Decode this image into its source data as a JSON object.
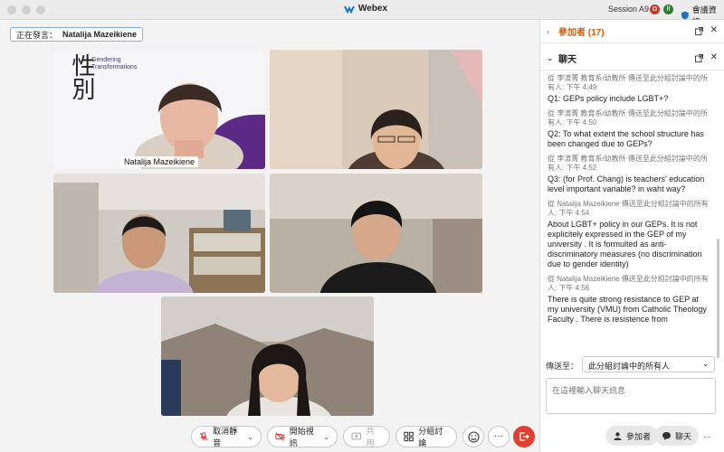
{
  "window": {
    "app_name": "Webex",
    "session": "Session A9",
    "meeting_info": "會議資訊",
    "badges": [
      {
        "text": "O",
        "color": "#c0392b"
      },
      {
        "text": "ll",
        "color": "#2e7d32"
      }
    ]
  },
  "speaker": {
    "prefix": "正在發言：",
    "name": "Natalija Mazeikiene"
  },
  "tiles": [
    {
      "label": "Natalija Mazeikiene",
      "logo_chars": "性別",
      "logo_text": "Gendering Transformations"
    },
    {
      "label": ""
    },
    {
      "label": ""
    },
    {
      "label": ""
    },
    {
      "label": ""
    }
  ],
  "toolbar": {
    "unmute": "取消靜音",
    "start_video": "開始視訊",
    "share": "共用",
    "breakout": "分組討論"
  },
  "panel": {
    "participants_title": "參加者 (17)",
    "chat_title": "聊天",
    "send_to_label": "傳送至：",
    "send_to_value": "此分組討論中的所有人",
    "input_placeholder": "在這裡輸入聊天訊息",
    "participants_button": "參加者",
    "chat_button": "聊天",
    "more": "..."
  },
  "messages": [
    {
      "meta": "從 李淯菁 教育系/幼教所 傳送至此分組討論中的所有人:  下午 4:49",
      "text": "Q1: GEPs policy include LGBT+?"
    },
    {
      "meta": "從 李淯菁 教育系/幼教所 傳送至此分組討論中的所有人:  下午 4:50",
      "text": "Q2: To what extent the school structure has been changed due to GEPs?"
    },
    {
      "meta": "從 李淯菁 教育系/幼教所 傳送至此分組討論中的所有人:  下午 4:52",
      "text": "Q3: (for Prof. Chang) is teachers' education level important variable? in waht way?"
    },
    {
      "meta": "從 Natalija Mazeikiene 傳送至此分組討論中的所有人:  下午 4:54",
      "text": "About LGBT+ policy in our GEPs. It is not explicitely expressed in the GEP of my university . It is formulted as anti-discriminatory measures (no discrimination due to gender identity)"
    },
    {
      "meta": "從 Natalija Mazeikiene 傳送至此分組討論中的所有人:  下午 4:56",
      "text": "There is quite strong resistance to GEP at my university (VMU) from Catholic Theology Faculty . There is resistence from"
    }
  ]
}
